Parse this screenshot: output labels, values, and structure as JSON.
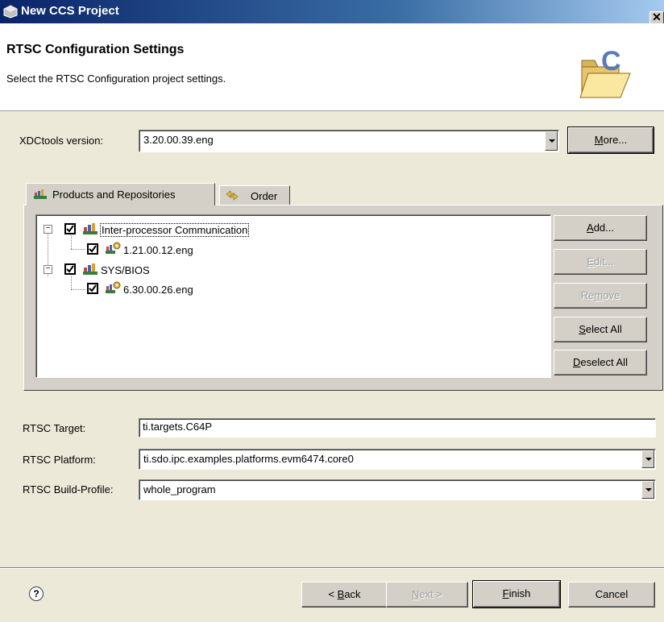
{
  "window": {
    "title": "New CCS Project",
    "close_glyph": "✕"
  },
  "header": {
    "title": "RTSC Configuration Settings",
    "description": "Select the RTSC Configuration project settings.",
    "icon": "folder-c-banner-icon"
  },
  "xdctools": {
    "label": "XDCtools version:",
    "value": "3.20.00.39.eng",
    "more_button": {
      "pre": "",
      "mnemonic": "M",
      "post": "ore..."
    }
  },
  "tabs": [
    {
      "label": "Products and Repositories",
      "active": true,
      "icon": "repository-icon"
    },
    {
      "label": "Order",
      "active": false,
      "icon": "order-arrows-icon"
    }
  ],
  "tree": [
    {
      "label": "Inter-processor Communication",
      "checked": true,
      "expanded": true,
      "icon": "product-books-icon",
      "children": [
        {
          "label": "1.21.00.12.eng",
          "checked": true,
          "icon": "version-gear-icon"
        }
      ]
    },
    {
      "label": "SYS/BIOS",
      "checked": true,
      "expanded": true,
      "icon": "product-books-icon",
      "children": [
        {
          "label": "6.30.00.26.eng",
          "checked": true,
          "icon": "version-gear-icon"
        }
      ]
    }
  ],
  "side_buttons": {
    "add": {
      "pre": "",
      "mnemonic": "A",
      "post": "dd...",
      "enabled": true
    },
    "edit": {
      "pre": "",
      "mnemonic": "E",
      "post": "dit...",
      "enabled": false
    },
    "remove": {
      "pre": "Re",
      "mnemonic": "m",
      "post": "ove",
      "enabled": false
    },
    "select_all": {
      "pre": "",
      "mnemonic": "S",
      "post": "elect All",
      "enabled": true
    },
    "deselect_all": {
      "pre": "",
      "mnemonic": "D",
      "post": "eselect All",
      "enabled": true
    }
  },
  "rtsc": {
    "target_label": "RTSC Target:",
    "target_value": "ti.targets.C64P",
    "platform_label": "RTSC Platform:",
    "platform_value": "ti.sdo.ipc.examples.platforms.evm6474.core0",
    "profile_label": "RTSC Build-Profile:",
    "profile_value": "whole_program"
  },
  "footer": {
    "help_glyph": "?",
    "back": {
      "pre": "< ",
      "mnemonic": "B",
      "post": "ack",
      "enabled": true
    },
    "next": {
      "pre": "",
      "mnemonic": "N",
      "post": "ext >",
      "enabled": false
    },
    "finish": {
      "pre": "",
      "mnemonic": "F",
      "post": "inish",
      "enabled": true
    },
    "cancel": {
      "pre": "",
      "mnemonic": "",
      "post": "Cancel",
      "enabled": true
    }
  },
  "colors": {
    "titlebar_start": "#0a246a",
    "titlebar_end": "#a6caf0",
    "dialog_bg": "#ece9d8",
    "panel_bg": "#d4d0c8"
  }
}
